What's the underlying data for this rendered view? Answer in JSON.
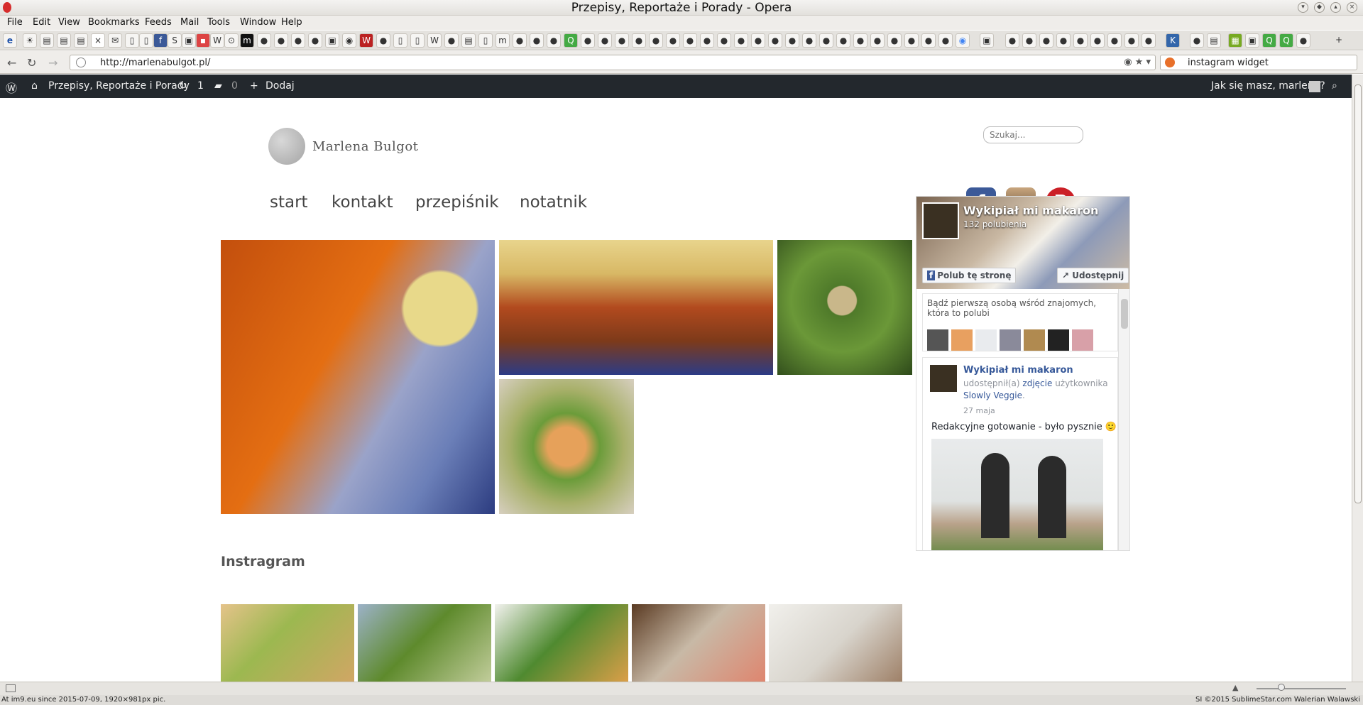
{
  "window": {
    "title": "Przepisy, Reportaże i Porady - Opera"
  },
  "menu": [
    "File",
    "Edit",
    "View",
    "Bookmarks",
    "Feeds",
    "Mail",
    "Tools",
    "Window",
    "Help"
  ],
  "address_bar": {
    "url": "http://marlenabulgot.pl/",
    "search_query": "instagram widget"
  },
  "wp_admin_bar": {
    "site_name": "Przepisy, Reportaże i Porady",
    "updates_count": "1",
    "comments_count": "0",
    "new_label": "Dodaj",
    "greeting": "Jak się masz, marlena?"
  },
  "site": {
    "logo_text": "Marlena Bulgot",
    "search_placeholder": "Szukaj...",
    "nav": [
      "start",
      "kontakt",
      "przepiśnik",
      "notatnik"
    ],
    "instagram_heading": "Instragram"
  },
  "facebook_widget": {
    "page_name": "Wykipiał mi makaron",
    "likes": "132 polubienia",
    "like_button": "Polub tę stronę",
    "share_button": "Udostępnij",
    "friends_prompt": "Bądź pierwszą osobą wśród znajomych, która to polubi",
    "post": {
      "author": "Wykipiał mi makaron",
      "action_prefix": "udostępnił(a)",
      "action_link": "zdjęcie",
      "action_suffix": "użytkownika",
      "source": "Slowly Veggie",
      "date": "27 maja",
      "text": "Redakcyjne gotowanie - było pysznie 🙂"
    }
  },
  "footer": {
    "left": "At im9.eu since 2015-07-09, 1920×981px pic.",
    "right": "SI ©2015 SublimeStar.com Walerian Walawski"
  },
  "colors": {
    "wp_bar": "#23282d",
    "facebook": "#3b5998",
    "pinterest": "#cb2027",
    "link": "#365899"
  }
}
